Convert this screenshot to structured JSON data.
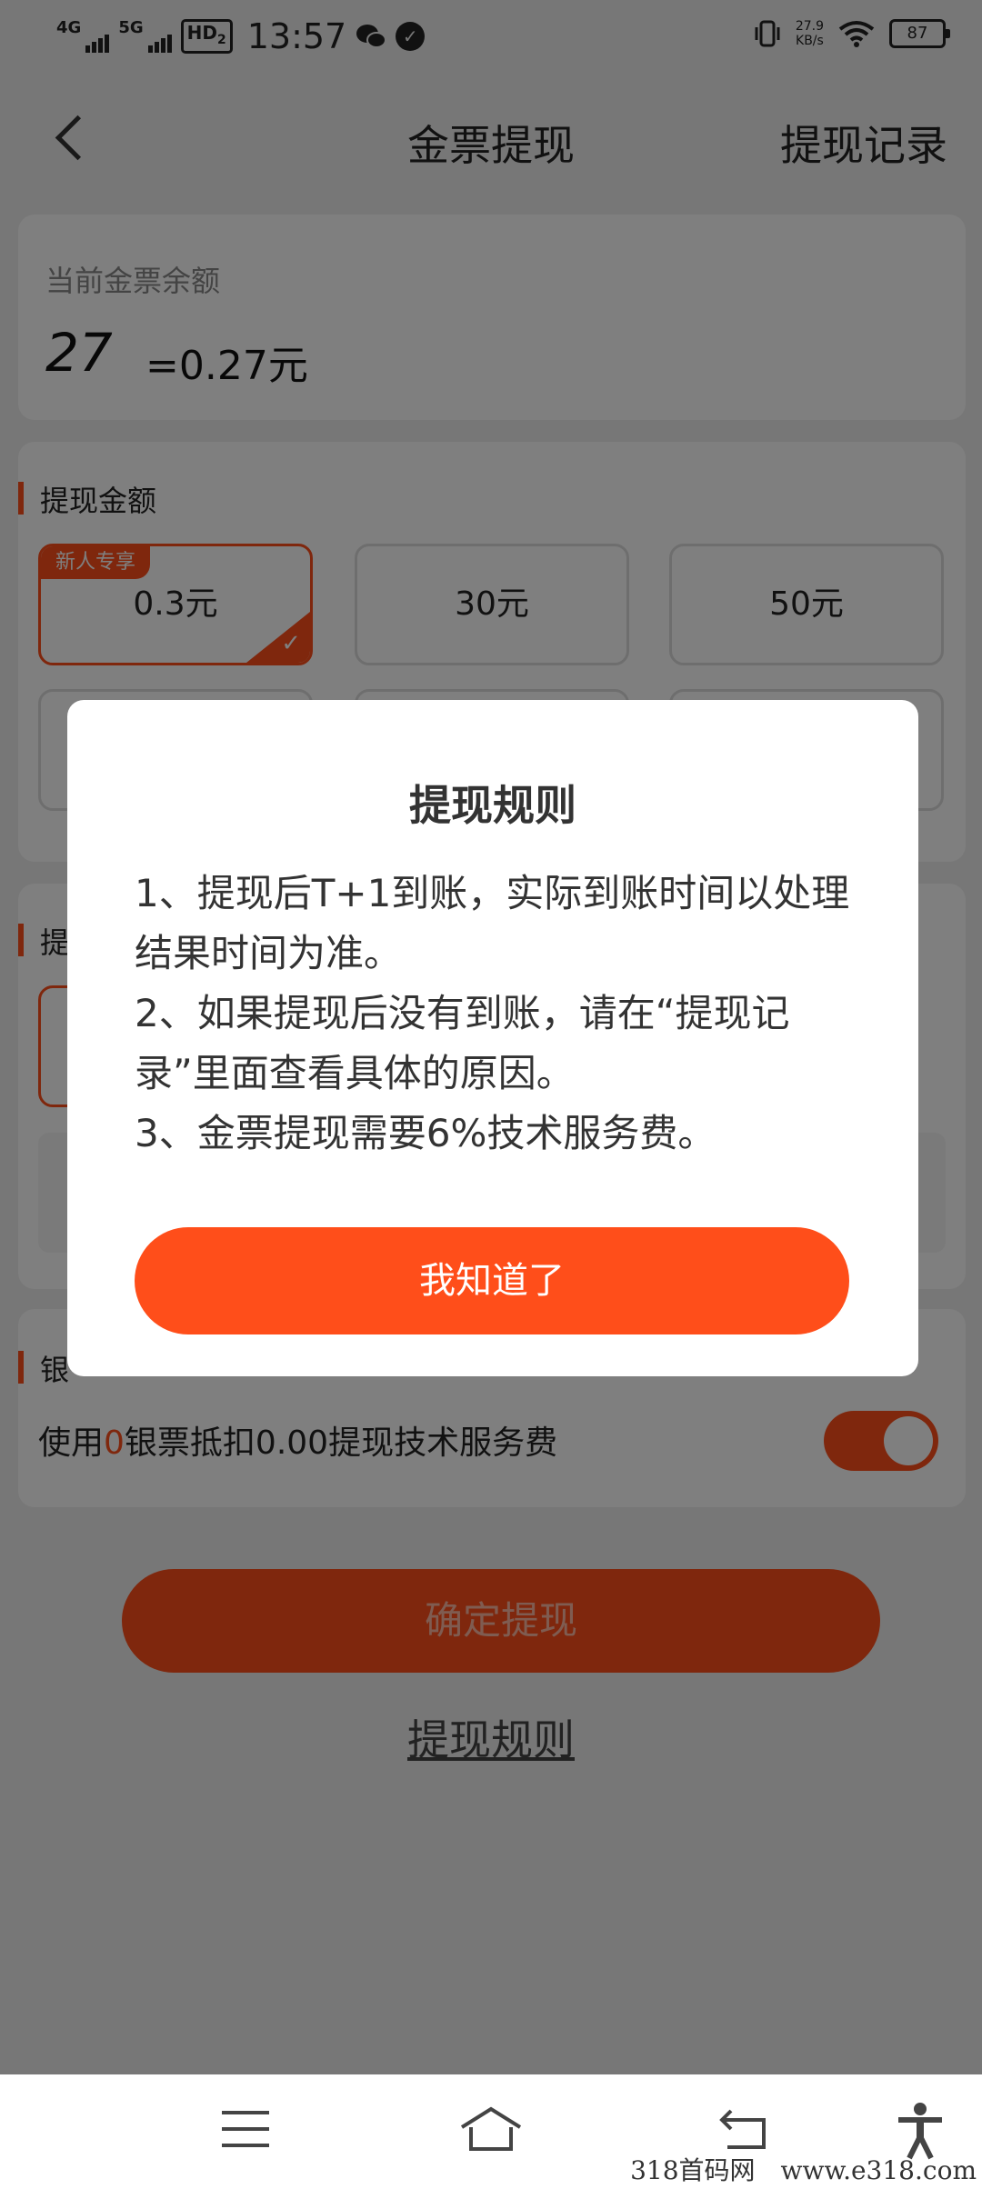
{
  "status_bar": {
    "network1": "4G",
    "network2": "5G",
    "hd": "HD",
    "hd_sub": "2",
    "time": "13:57",
    "speed_value": "27.9",
    "speed_unit": "KB/s",
    "battery": "87"
  },
  "nav": {
    "title": "金票提现",
    "right_action": "提现记录"
  },
  "balance": {
    "label": "当前金票余额",
    "value": "27",
    "equivalent": "=0.27元"
  },
  "amount": {
    "section_label": "提现金额",
    "options": [
      {
        "label": "0.3元",
        "tag": "新人专享",
        "selected": true
      },
      {
        "label": "30元"
      },
      {
        "label": "50元"
      }
    ]
  },
  "method": {
    "section_label_partial": "提"
  },
  "silver": {
    "section_label_partial": "银",
    "text_prefix": "使用",
    "count": "0",
    "text_suffix": "银票抵扣0.00提现技术服务费",
    "toggle_on": true
  },
  "confirm_button": "确定提现",
  "rules_link": "提现规则",
  "dialog": {
    "title": "提现规则",
    "lines": [
      "1、提现后T+1到账，实际到账时间以处理结果时间为准。",
      "2、如果提现后没有到账，请在“提现记录”里面查看具体的原因。",
      "3、金票提现需要6%技术服务费。"
    ],
    "ok_button": "我知道了"
  },
  "watermark": "318首码网　www.e318.com"
}
